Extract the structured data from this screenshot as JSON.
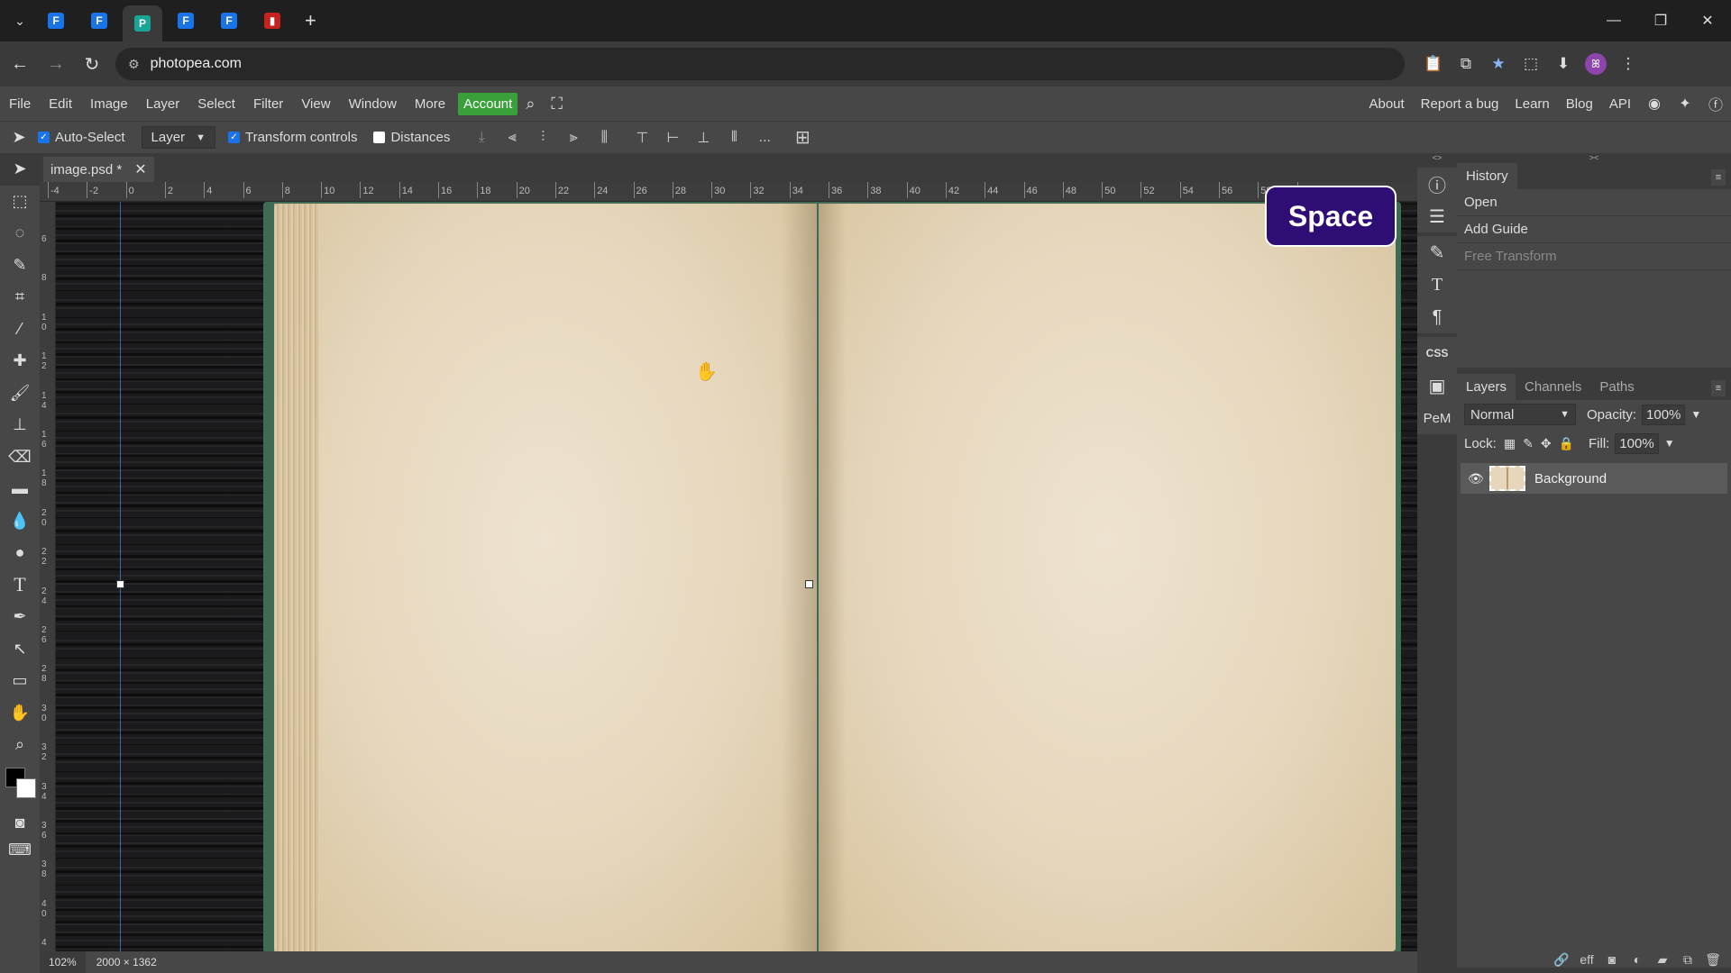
{
  "browser": {
    "url": "photopea.com",
    "tabs": [
      {
        "letter": "F",
        "style": "blue"
      },
      {
        "letter": "F",
        "style": "blue"
      },
      {
        "letter": "P",
        "style": "green"
      },
      {
        "letter": "F",
        "style": "blue"
      },
      {
        "letter": "F",
        "style": "blue"
      },
      {
        "letter": "▮",
        "style": "red"
      }
    ],
    "avatar_letter": "ꕤ"
  },
  "menu": {
    "items": [
      "File",
      "Edit",
      "Image",
      "Layer",
      "Select",
      "Filter",
      "View",
      "Window",
      "More"
    ],
    "account": "Account",
    "right_items": [
      "About",
      "Report a bug",
      "Learn",
      "Blog",
      "API"
    ]
  },
  "options": {
    "auto_select": "Auto-Select",
    "layer_select": "Layer",
    "transform_controls": "Transform controls",
    "distances": "Distances",
    "more": "..."
  },
  "document": {
    "tab_title": "image.psd *",
    "zoom": "102%",
    "size": "2000 × 1362"
  },
  "rulers": {
    "h_ticks": [
      "-4",
      "-2",
      "0",
      "2",
      "4",
      "6",
      "8",
      "10",
      "12",
      "14",
      "16",
      "18",
      "20",
      "22",
      "24",
      "26",
      "28",
      "30",
      "32",
      "34",
      "36",
      "38",
      "40",
      "42",
      "44",
      "46",
      "48",
      "50",
      "52",
      "54",
      "56",
      "58",
      "6"
    ],
    "v_ticks": [
      "6",
      "8",
      "1\n0",
      "1\n2",
      "1\n4",
      "1\n6",
      "1\n8",
      "2\n0",
      "2\n2",
      "2\n4",
      "2\n6",
      "2\n8",
      "3\n0",
      "3\n2",
      "3\n4",
      "3\n6",
      "3\n8",
      "4\n0",
      "4"
    ]
  },
  "overlay": {
    "key_badge": "Space"
  },
  "icon_strip": {
    "css_label": "CSS",
    "pem_label": "PeM"
  },
  "history": {
    "tab": "History",
    "items": [
      {
        "label": "Open",
        "state": "normal"
      },
      {
        "label": "Add Guide",
        "state": "normal"
      },
      {
        "label": "Free Transform",
        "state": "undone"
      }
    ]
  },
  "layers": {
    "tabs": [
      "Layers",
      "Channels",
      "Paths"
    ],
    "blend_mode": "Normal",
    "opacity_label": "Opacity:",
    "opacity": "100%",
    "lock_label": "Lock:",
    "fill_label": "Fill:",
    "fill": "100%",
    "items": [
      {
        "name": "Background"
      }
    ],
    "footer_links": "eff"
  },
  "colors": {
    "accent_green": "#3aa13a",
    "badge_purple": "#2e0d75",
    "panel_bg": "#474747"
  }
}
